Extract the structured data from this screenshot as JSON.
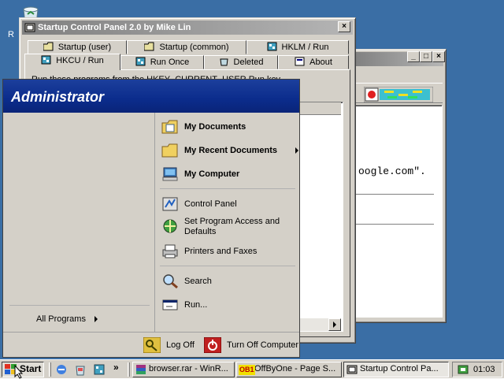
{
  "desktop": {
    "icon_label": "R"
  },
  "back_window": {
    "min_label": "_",
    "max_label": "□",
    "close_label": "×",
    "body_text": "oogle.com\". "
  },
  "startup_window": {
    "title": "Startup Control Panel 2.0 by Mike Lin",
    "close_label": "×",
    "tabs_row1": [
      "Startup (user)",
      "Startup (common)",
      "HKLM / Run"
    ],
    "tabs_row2": [
      "HKCU / Run",
      "Run Once",
      "Deleted",
      "About"
    ],
    "description": "Run these programs from the HKEY_CURRENT_USER Run key"
  },
  "start_menu": {
    "user_name": "Administrator",
    "all_programs": "All Programs",
    "items": {
      "my_documents": "My Documents",
      "my_recent_documents": "My Recent Documents",
      "my_computer": "My Computer",
      "control_panel": "Control Panel",
      "set_program_access": "Set Program Access and",
      "set_program_access_line2": "Defaults",
      "printers_and_faxes": "Printers and Faxes",
      "search": "Search",
      "run": "Run..."
    },
    "log_off": "Log Off",
    "turn_off": "Turn Off Computer"
  },
  "taskbar": {
    "start_label": "Start",
    "quick_launch_more": "»",
    "tasks": [
      {
        "label": "browser.rar - WinR..."
      },
      {
        "label": "OffByOne - Page S...",
        "icon_text": "OB1"
      },
      {
        "label": "Startup Control Pa..."
      }
    ],
    "clock": "01:03"
  },
  "colors": {
    "desktop": "#3a6ea5",
    "start_menu_header": "#0b2c8c",
    "active_title": "#0a246a"
  }
}
